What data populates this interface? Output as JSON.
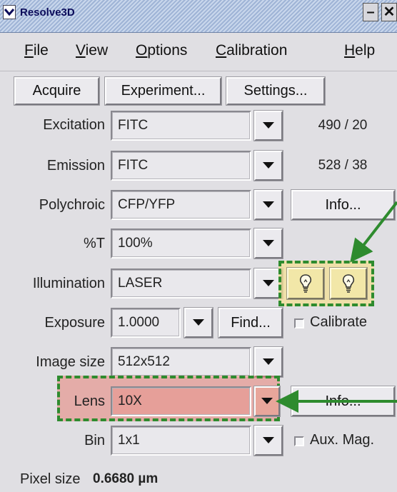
{
  "window": {
    "title": "Resolve3D",
    "minimize_label": "–",
    "close_label": "✕"
  },
  "menu": {
    "file": "F",
    "file_rest": "ile",
    "view": "V",
    "view_rest": "iew",
    "options": "O",
    "options_rest": "ptions",
    "calibration": "C",
    "calibration_rest": "alibration",
    "help": "H",
    "help_rest": "elp"
  },
  "toolbar": {
    "acquire": "Acquire",
    "experiment": "Experiment...",
    "settings": "Settings..."
  },
  "rows": {
    "excitation": {
      "label": "Excitation",
      "value": "FITC",
      "info": "490 / 20"
    },
    "emission": {
      "label": "Emission",
      "value": "FITC",
      "info": "528 / 38"
    },
    "polychroic": {
      "label": "Polychroic",
      "value": "CFP/YFP",
      "button": "Info..."
    },
    "transmission": {
      "label": "%T",
      "value": "100%"
    },
    "illumination": {
      "label": "Illumination",
      "value": "LASER"
    },
    "exposure": {
      "label": "Exposure",
      "value": "1.0000",
      "find": "Find...",
      "calibrate": "Calibrate"
    },
    "image_size": {
      "label": "Image size",
      "value": "512x512"
    },
    "lens": {
      "label": "Lens",
      "value": "10X",
      "button": "Info..."
    },
    "bin": {
      "label": "Bin",
      "value": "1x1",
      "aux": "Aux. Mag."
    },
    "pixel": {
      "label": "Pixel size",
      "value": "0.6680 µm"
    }
  },
  "icons": {
    "dropdown": "chevron-down-icon",
    "bulb": "lightbulb-icon"
  },
  "colors": {
    "highlight_green": "#2e8b2e",
    "highlight_yellow": "#f4e096",
    "highlight_red": "#e88278"
  }
}
